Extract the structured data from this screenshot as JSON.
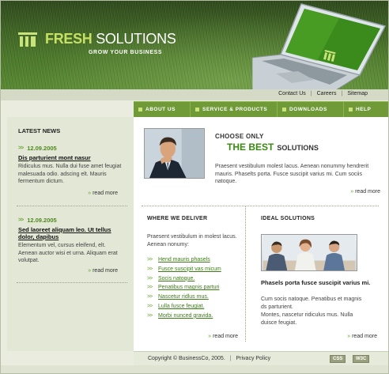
{
  "brand": {
    "name_part1": "FRESH",
    "name_part2": "SOLUTIONS",
    "tagline": "GROW YOUR BUSINESS"
  },
  "toplinks": [
    "Contact Us",
    "|",
    "Careers",
    "|",
    "Sitemap"
  ],
  "menu": [
    "ABOUT US",
    "SERVICE & PRODUCTS",
    "DOWNLOADS",
    "HELP"
  ],
  "sidebar": {
    "heading": "LATEST NEWS",
    "news": [
      {
        "date": "12.09.2005",
        "title": "Dis parturient mont nasur",
        "text": "Ridiculus mus. Nulla dui fuse amet feugiat malesuada odio. adscing elt. Mauris fermentum dictum.",
        "more": "read more"
      },
      {
        "date": "12.09.2005",
        "title": "Sed laoreet aliquam leo. Ut tellus dolor, dapibus",
        "text": "Elementum vel, cursus eleifend, elt. Aenean auctor wisi et urna. Aliquam erat volutpat.",
        "more": "read more"
      }
    ]
  },
  "main": {
    "choose": "CHOOSE ONLY",
    "best": "THE BEST",
    "solutions": "SOLUTIONS",
    "intro": "Praesent vestibulum molest lacus. Aenean nonummy hendrerit mauris. Phaselts porta. Fusce suscipit varius mi. Cum sociis natoque.",
    "more": "read more",
    "where": {
      "heading": "WHERE WE DELIVER",
      "text": "Praesent vestibulum in molest lacus. Aenean nonumy:",
      "links": [
        "Hend mauris phasels",
        "Fusce suscipit vas micum",
        "Socis natoque.",
        "Penatibus magnis parturi",
        "Nascetur ridlus mus.",
        "Lulla fusce feugiat.",
        "Morbi nunced gravida."
      ],
      "more": "read more"
    },
    "ideal": {
      "heading": "IDEAL SOLUTIONS",
      "title": "Phasels porta fusce suscipit varius mi.",
      "text1": "Cum socis natoque. Penatibus et magnis ds parturient.",
      "text2": "Montes, nascetur ridiculus mus. Nulla duisce feugiat.",
      "more": "read more"
    }
  },
  "footer": {
    "copyright": "Copyright © BusinessCo, 2005.",
    "sep": "|",
    "privacy": "Privacy Policy",
    "badge_css": "CSS",
    "badge_w3c": "W3C"
  },
  "colors": {
    "accent_green": "#6f9a37",
    "date_green": "#4f8a1e",
    "best_green": "#3a8a12"
  }
}
